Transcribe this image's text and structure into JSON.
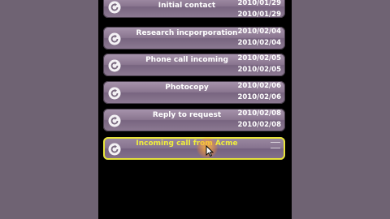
{
  "list": {
    "items": [
      {
        "title": "Initial contact",
        "date1": "2010/01/29",
        "date2": "2010/01/29"
      },
      {
        "title": "Research incporporation",
        "date1": "2010/02/04",
        "date2": "2010/02/04"
      },
      {
        "title": "Phone call incoming",
        "date1": "2010/02/05",
        "date2": "2010/02/05"
      },
      {
        "title": "Photocopy",
        "date1": "2010/02/06",
        "date2": "2010/02/06"
      },
      {
        "title": "Reply to request",
        "date1": "2010/02/08",
        "date2": "2010/02/08"
      }
    ],
    "active": {
      "title": "Incoming call from Acme"
    }
  },
  "colors": {
    "background": "#6f6373",
    "row": "#8a7690",
    "highlight": "#e8e43a"
  },
  "icons": {
    "row": "refresh-icon",
    "drag": "drag-handle-icon"
  }
}
